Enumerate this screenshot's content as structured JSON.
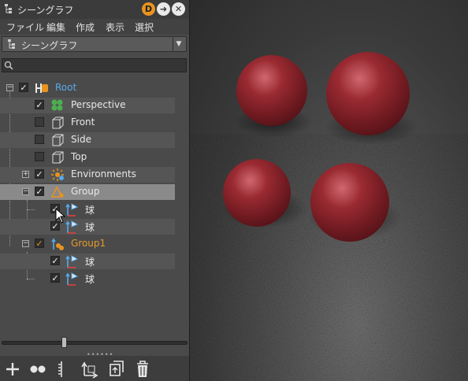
{
  "window": {
    "title": "シーングラフ",
    "badge_d": "D"
  },
  "menu": {
    "items": [
      "ファイル",
      "編集",
      "作成",
      "表示",
      "選択"
    ]
  },
  "view_selector": {
    "label": "シーングラフ"
  },
  "search": {
    "value": "",
    "placeholder": ""
  },
  "tree": {
    "nodes": [
      {
        "label": "Root",
        "checked": true,
        "icon": "root-node-icon"
      },
      {
        "label": "Perspective",
        "checked": true,
        "icon": "perspective-camera-icon"
      },
      {
        "label": "Front",
        "checked": false,
        "icon": "front-camera-icon"
      },
      {
        "label": "Side",
        "checked": false,
        "icon": "side-camera-icon"
      },
      {
        "label": "Top",
        "checked": false,
        "icon": "top-camera-icon"
      },
      {
        "label": "Environments",
        "checked": true,
        "icon": "environments-icon"
      },
      {
        "label": "Group",
        "checked": true,
        "icon": "group-icon",
        "selected": true
      },
      {
        "label": "球",
        "checked": true,
        "icon": "transform-icon"
      },
      {
        "label": "球",
        "checked": true,
        "icon": "transform-icon"
      },
      {
        "label": "Group1",
        "checked": true,
        "icon": "group-icon"
      },
      {
        "label": "球",
        "checked": true,
        "icon": "transform-icon"
      },
      {
        "label": "球",
        "checked": true,
        "icon": "transform-icon"
      }
    ]
  },
  "colors": {
    "root_label": "#5aa8e8",
    "group1_label": "#e89a2a",
    "badge_orange": "#e8941e",
    "sphere": "#8a2028"
  },
  "bottom_toolbar": {
    "icons": [
      "add-icon",
      "link-icon",
      "split-icon",
      "move-icon",
      "copy-icon",
      "trash-icon"
    ]
  }
}
